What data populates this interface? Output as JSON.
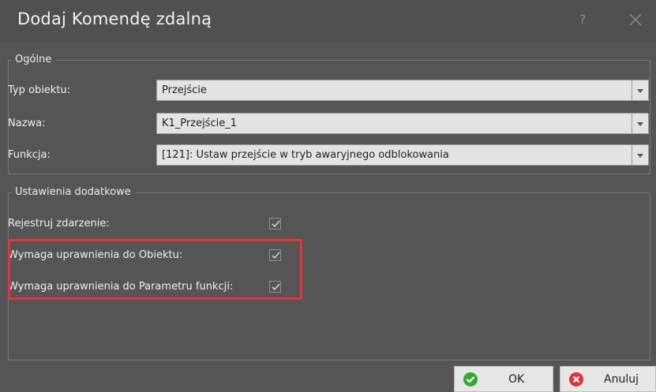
{
  "window": {
    "title": "Dodaj Komendę zdalną",
    "help_glyph": "?"
  },
  "general_group": {
    "title": "Ogólne",
    "fields": [
      {
        "label": "Typ obiektu:",
        "value": "Przejście"
      },
      {
        "label": "Nazwa:",
        "value": "K1_Przejście_1"
      },
      {
        "label": "Funkcja:",
        "value": "[121]: Ustaw przejście w tryb awaryjnego odblokowania"
      }
    ]
  },
  "extra_group": {
    "title": "Ustawienia dodatkowe",
    "options": [
      {
        "label": "Rejestruj zdarzenie:",
        "checked": true
      },
      {
        "label": "Wymaga uprawnienia do Obiektu:",
        "checked": true
      },
      {
        "label": "Wymaga uprawnienia do Parametru funkcji:",
        "checked": true
      }
    ]
  },
  "buttons": {
    "ok_label": "OK",
    "cancel_label": "Anuluj"
  },
  "colors": {
    "highlight": "#e5323b",
    "ok_icon": "#3aa635",
    "cancel_icon": "#d9363e"
  },
  "icons": {
    "help": "help-icon",
    "close": "close-icon",
    "dropdown": "chevron-down-icon",
    "check": "checkmark-icon",
    "ok": "check-circle-icon",
    "cancel": "x-circle-icon"
  }
}
